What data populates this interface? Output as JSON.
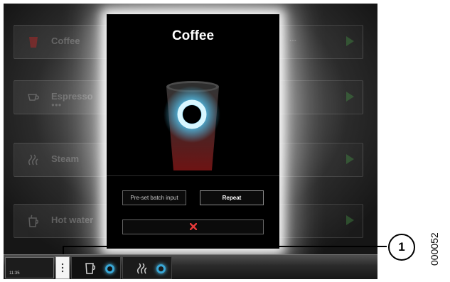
{
  "background_menu": {
    "items": [
      {
        "label": "Coffee",
        "sublabel": "",
        "icon": "cup-icon"
      },
      {
        "label": "Espresso",
        "sublabel": "●●●",
        "icon": "espresso-cup-icon"
      },
      {
        "label": "Steam",
        "sublabel": "",
        "icon": "steam-icon"
      },
      {
        "label": "Hot water",
        "sublabel": "",
        "icon": "hot-water-icon"
      }
    ]
  },
  "dialog": {
    "title": "Coffee",
    "preset_button": "Pre-set batch input",
    "repeat_button": "Repeat",
    "cancel_icon": "close-icon"
  },
  "status_bar": {
    "time": "11:35",
    "slot1_icon": "cup-icon",
    "slot2_icon": "steam-icon"
  },
  "annotation": {
    "callout_number": "1",
    "figure_id": "000052"
  },
  "colors": {
    "dialog_bg": "#000000",
    "glow_cyan": "#52c8f5",
    "cup_red": "#7a1616",
    "cancel_red": "#e83a3a",
    "progress_ring": "#39a8d8"
  }
}
